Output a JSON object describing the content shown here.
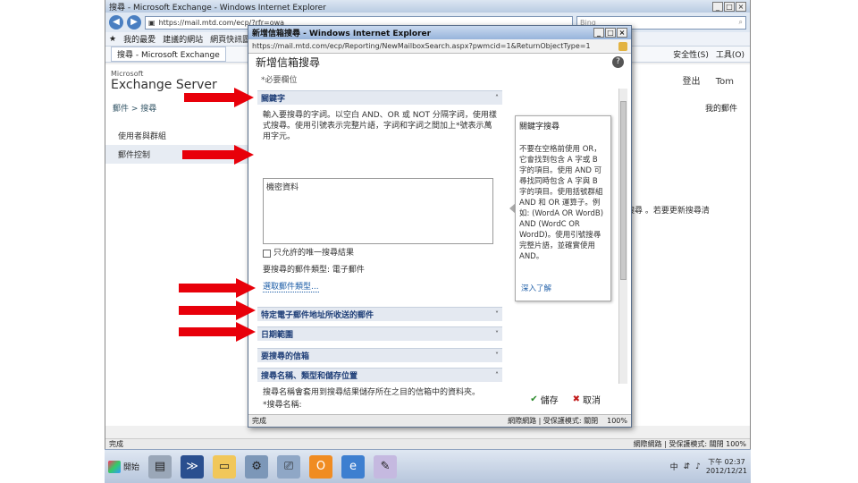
{
  "outer": {
    "title": "搜尋 - Microsoft Exchange - Windows Internet Explorer",
    "address": "https://mail.mtd.com/ecp/?rfr=owa",
    "search_placeholder": "Bing",
    "favorites": [
      "我的最愛",
      "建議的網站",
      "網頁快訊圖庫"
    ],
    "tab_label": "搜尋 - Microsoft Exchange",
    "menu_right": [
      "安全性(S)",
      "工具(O)"
    ],
    "logo_ms": "Microsoft",
    "logo_product": "Exchange Server",
    "head_right": [
      "登出",
      "Tom"
    ],
    "breadcrumb": "郵件 > 搜尋",
    "left_nav": [
      "使用者與群組",
      "郵件控制"
    ],
    "right_link": "我的郵件",
    "right_info": "搜尋 。若要更新搜尋清",
    "status": "完成",
    "status_right": "網際網路 | 受保護模式: 關閉    100%"
  },
  "popup": {
    "title": "新增信箱搜尋 - Windows Internet Explorer",
    "address": "https://mail.mtd.com/ecp/Reporting/NewMailboxSearch.aspx?pwmcid=1&ReturnObjectType=1",
    "header": "新增信箱搜尋",
    "help": "?",
    "required_note": "*必要欄位",
    "sections": {
      "keywords": "關鍵字",
      "sender": "特定電子郵件地址所收送的郵件",
      "date": "日期範圍",
      "mailboxes": "要搜尋的信箱",
      "name": "搜尋名稱、類型和儲存位置"
    },
    "kw_desc": "輸入要搜尋的字詞。以空白 AND、OR 或 NOT 分隔字詞，使用樣式搜尋。使用引號表示完整片語，字詞和字詞之間加上*號表示萬用字元。",
    "kw_value": "機密資料",
    "dedup_label": "只允許的唯一搜尋結果",
    "types_label": "要搜尋的郵件類型: 電子郵件",
    "types_link": "選取郵件類型...",
    "name_desc": "搜尋名稱會套用到搜尋結果儲存所在之目的信箱中的資料夾。",
    "name_field": "*搜尋名稱:",
    "tip": {
      "title": "關鍵字搜尋",
      "body": "不要在空格前使用 OR，它會找到包含 A 字或 B 字的項目。使用 AND 可尋找同時包含 A 字與 B 字的項目。使用括號群組 AND 和 OR 運算子。例如: (WordA OR WordB) AND (WordC OR WordD)。使用引號搜尋完整片語，並確實使用 AND。",
      "link": "深入了解"
    },
    "save": "儲存",
    "cancel": "取消",
    "status_left": "完成",
    "status_mid": "網際網路 | 受保護模式: 關閉",
    "zoom": "100%"
  },
  "taskbar": {
    "start": "開始",
    "icons": [
      "server-icon",
      "powershell-icon",
      "explorer-folder-icon",
      "tools-icon",
      "network-icon",
      "outlook-icon",
      "ie-icon",
      "wizard-icon"
    ],
    "clock_time": "下午 02:37",
    "clock_date": "2012/12/21"
  },
  "colors": {
    "arrow": "#e8000a",
    "section_text": "#1f3f78",
    "section_bg": "#e4e9f1"
  }
}
